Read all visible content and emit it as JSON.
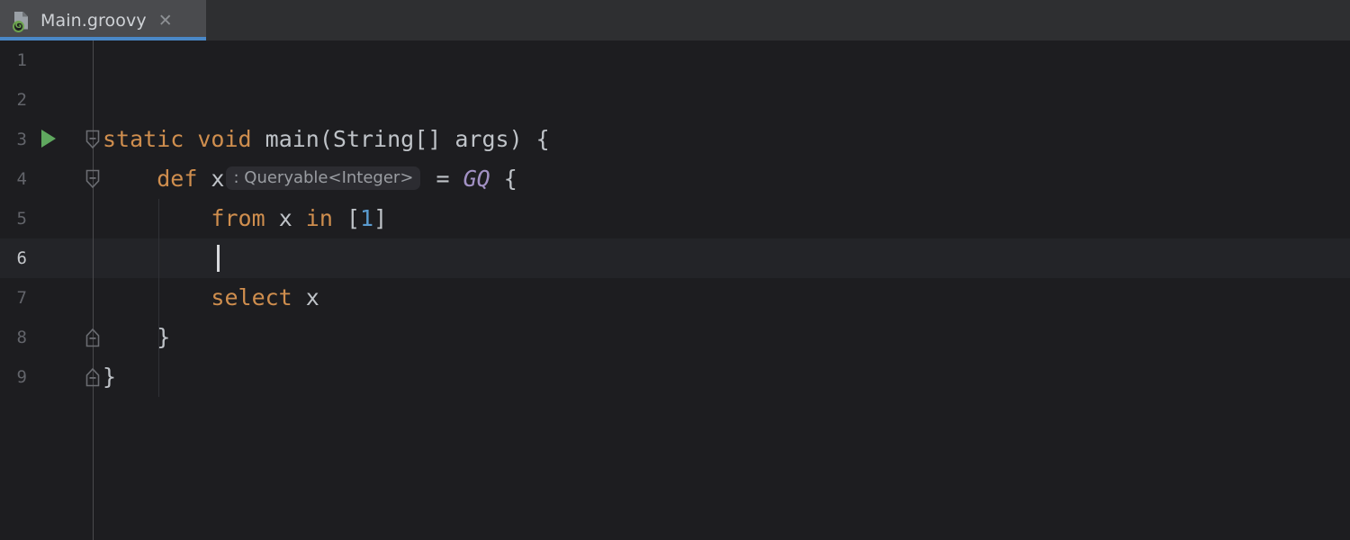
{
  "window": {
    "theme_background": "#1d1d20",
    "accent_color": "#4a88c7"
  },
  "tabbar": {
    "background": "#2e2f31",
    "active_tab": {
      "title": "Main.groovy",
      "icon": "groovy-file-icon",
      "badge_letter": "G",
      "badge_color": "#6ca34e",
      "close_label": "✕",
      "underline_color": "#4a88c7"
    }
  },
  "editor": {
    "language": "Groovy",
    "caret_line": 6,
    "caret_column": 9,
    "gutter": {
      "line_numbers": [
        "1",
        "2",
        "3",
        "4",
        "5",
        "6",
        "7",
        "8",
        "9"
      ],
      "run_marker_line": 3,
      "run_marker_label": "run-gutter-icon",
      "fold_open_lines": [
        3,
        4
      ],
      "fold_close_lines": [
        8,
        9
      ]
    },
    "lines": [
      {
        "n": 1,
        "tokens": []
      },
      {
        "n": 2,
        "tokens": []
      },
      {
        "n": 3,
        "tokens": [
          {
            "t": "static void",
            "c": "kw"
          },
          {
            "t": " ",
            "c": "txt"
          },
          {
            "t": "main(String[] args) {",
            "c": "txt"
          }
        ]
      },
      {
        "n": 4,
        "tokens": [
          {
            "t": "    ",
            "c": "txt"
          },
          {
            "t": "def",
            "c": "kw"
          },
          {
            "t": " x",
            "c": "txt"
          },
          {
            "t": ": Queryable<Integer>",
            "c": "hint"
          },
          {
            "t": " = ",
            "c": "txt"
          },
          {
            "t": "GQ",
            "c": "gq"
          },
          {
            "t": " {",
            "c": "txt"
          }
        ]
      },
      {
        "n": 5,
        "tokens": [
          {
            "t": "        ",
            "c": "txt"
          },
          {
            "t": "from",
            "c": "kw"
          },
          {
            "t": " x ",
            "c": "txt"
          },
          {
            "t": "in",
            "c": "kw"
          },
          {
            "t": " [",
            "c": "txt"
          },
          {
            "t": "1",
            "c": "num"
          },
          {
            "t": "]",
            "c": "txt"
          }
        ]
      },
      {
        "n": 6,
        "tokens": []
      },
      {
        "n": 7,
        "tokens": [
          {
            "t": "        ",
            "c": "txt"
          },
          {
            "t": "select",
            "c": "kw"
          },
          {
            "t": " x",
            "c": "txt"
          }
        ]
      },
      {
        "n": 8,
        "tokens": [
          {
            "t": "    }",
            "c": "txt"
          }
        ]
      },
      {
        "n": 9,
        "tokens": [
          {
            "t": "}",
            "c": "txt"
          }
        ]
      }
    ],
    "colors": {
      "keyword": "#cf8e4e",
      "text": "#bfc3c8",
      "number": "#5a9bcf",
      "class_ref": "#a291c4",
      "inlay_hint_text": "#9a9da2",
      "inlay_hint_background": "#2c2c31",
      "caret_row_background": "#232428",
      "line_number": "#62646a",
      "line_number_current": "#c6c9cd"
    }
  }
}
